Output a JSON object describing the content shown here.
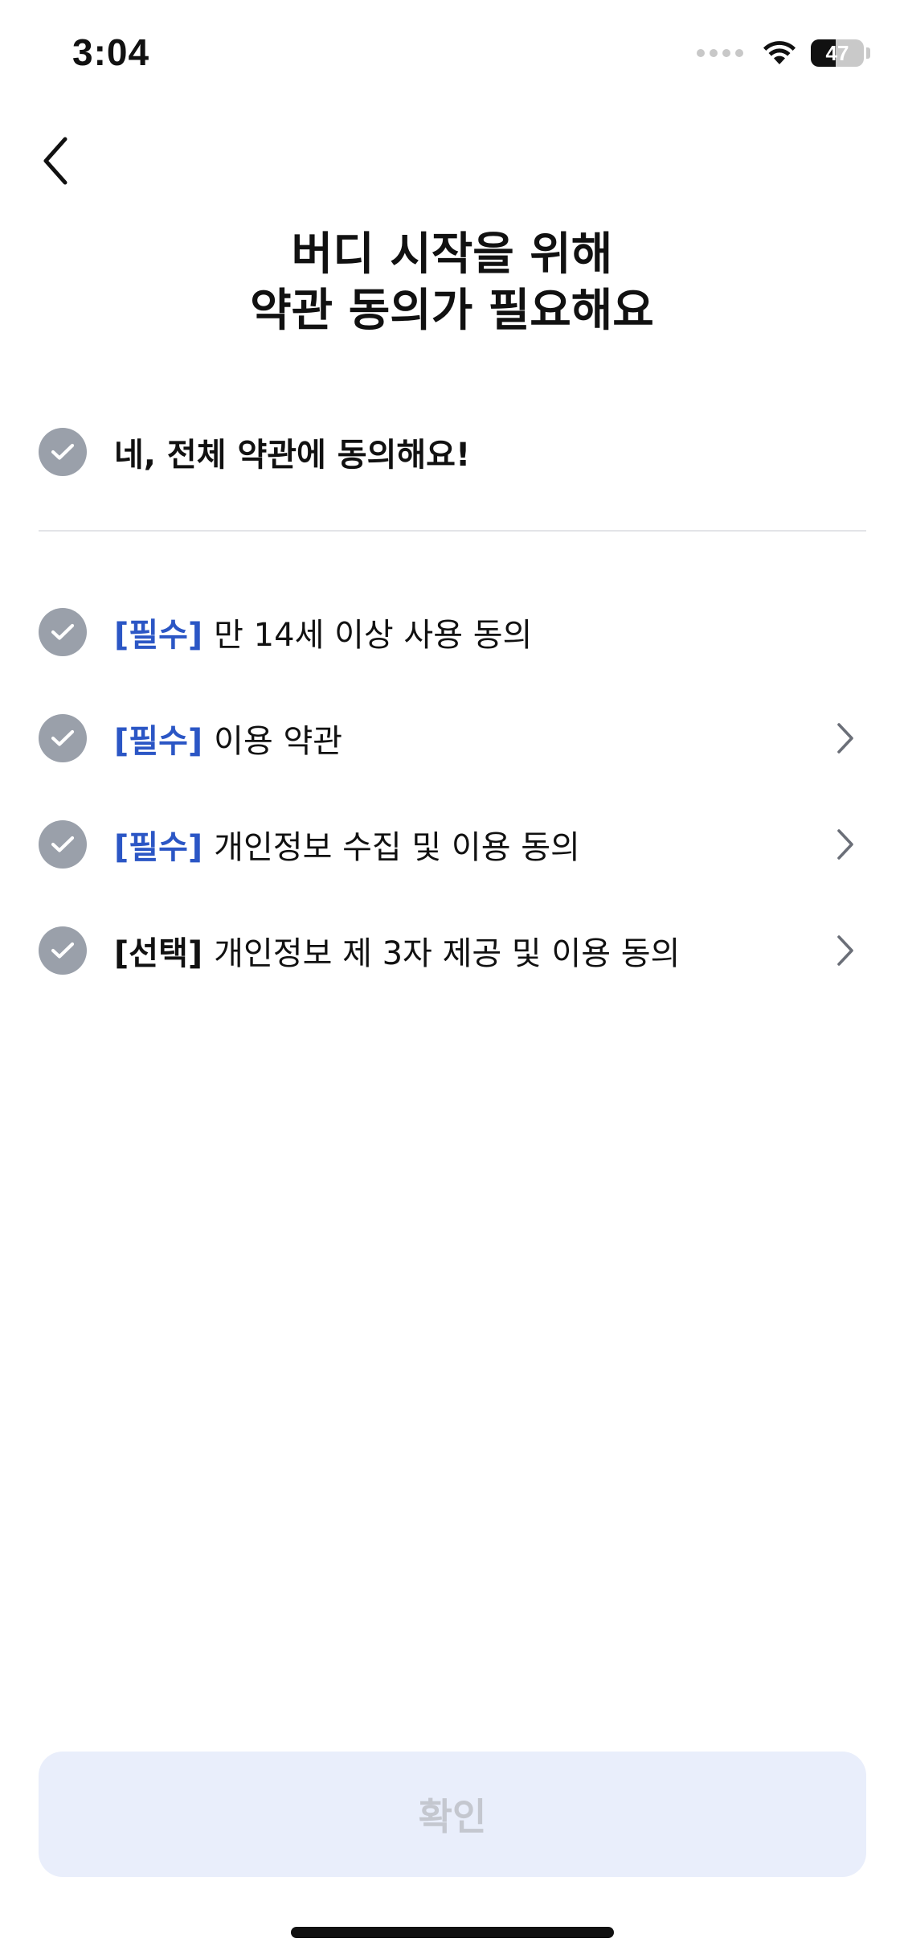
{
  "status_bar": {
    "time": "3:04",
    "battery_level": "47",
    "battery_fraction": 0.47
  },
  "header": {
    "back_icon": "chevron-left-icon",
    "title_line1": "버디 시작을 위해",
    "title_line2": "약관 동의가 필요해요"
  },
  "agree_all": {
    "label": "네, 전체 약관에 동의해요!",
    "checked": false
  },
  "terms": [
    {
      "tag": "[필수]",
      "type": "required",
      "label": "만 14세 이상 사용 동의",
      "has_detail": false
    },
    {
      "tag": "[필수]",
      "type": "required",
      "label": "이용 약관",
      "has_detail": true
    },
    {
      "tag": "[필수]",
      "type": "required",
      "label": "개인정보 수집 및 이용 동의",
      "has_detail": true
    },
    {
      "tag": "[선택]",
      "type": "optional",
      "label": "개인정보 제 3자 제공 및 이용 동의",
      "has_detail": true
    }
  ],
  "confirm": {
    "label": "확인",
    "enabled": false
  },
  "colors": {
    "required_tag": "#2b56c5",
    "check_inactive": "#9aa0aa",
    "button_disabled_bg": "#e9eefb",
    "button_disabled_text": "#c4c7cf"
  }
}
